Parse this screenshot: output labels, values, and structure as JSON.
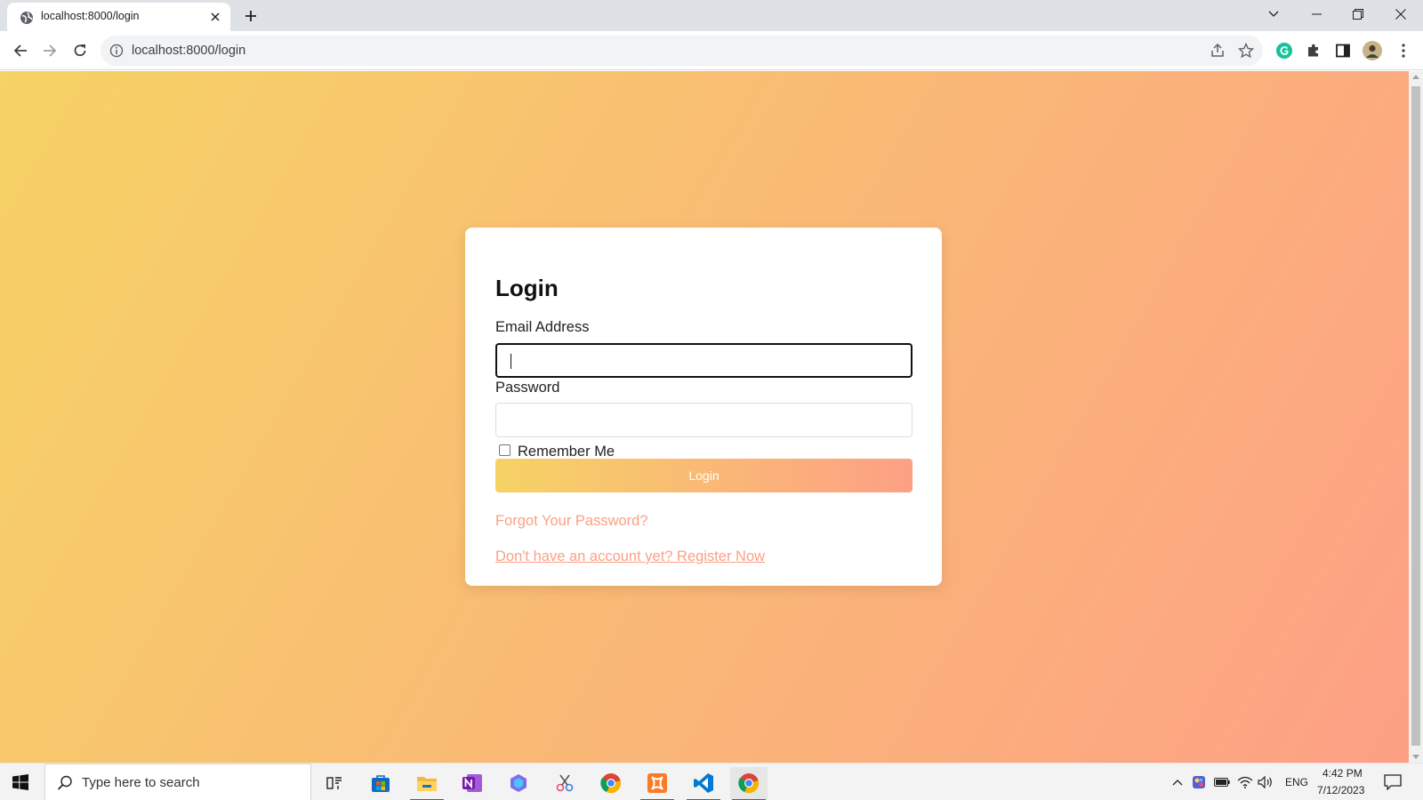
{
  "browser": {
    "tab_title": "localhost:8000/login",
    "url": "localhost:8000/login"
  },
  "page": {
    "gradient_start": "#f6d365",
    "gradient_end": "#fda085"
  },
  "login_form": {
    "title": "Login",
    "email_label": "Email Address",
    "email_value": "",
    "password_label": "Password",
    "password_value": "",
    "remember_label": "Remember Me",
    "remember_checked": false,
    "submit_label": "Login",
    "forgot_link": "Forgot Your Password?",
    "register_link": "Don't have an account yet? Register Now"
  },
  "taskbar": {
    "search_placeholder": "Type here to search",
    "language": "ENG",
    "time": "4:42 PM",
    "date": "7/12/2023",
    "apps": [
      "task-view",
      "microsoft-store",
      "file-explorer",
      "onenote",
      "copilot",
      "snipping-tool",
      "chrome",
      "xampp",
      "vscode",
      "chrome"
    ]
  }
}
